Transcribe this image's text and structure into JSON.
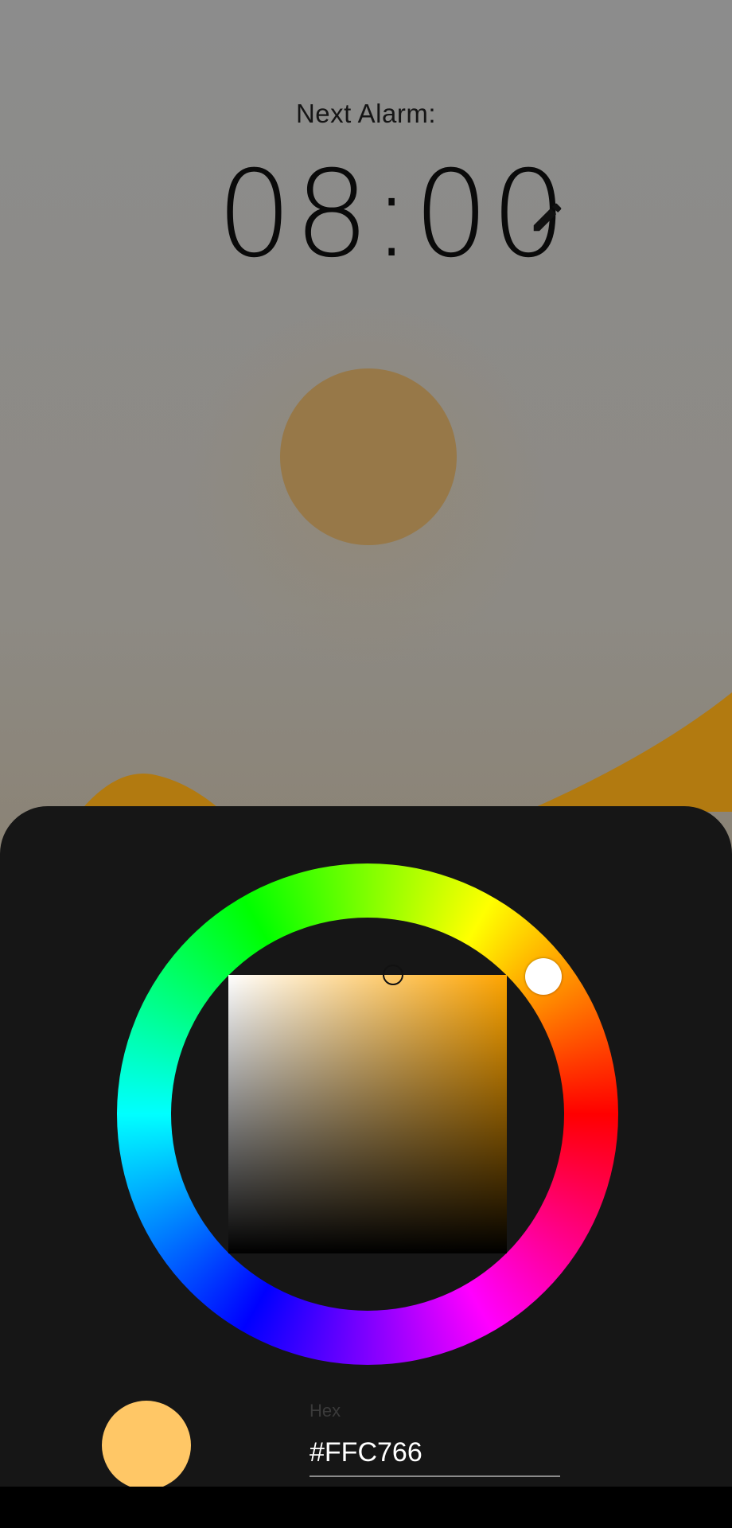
{
  "alarm": {
    "label": "Next Alarm:",
    "time": "08:00"
  },
  "icons": {
    "edit": "pencil-icon"
  },
  "color_picker": {
    "hex_label": "Hex",
    "hex_value": "#FFC766",
    "selected_color": "#FFC766",
    "hue_base_color": "#FFA500"
  },
  "colors": {
    "sheet_background": "#161616",
    "scene_sun": "#977848",
    "scene_hills": "#b27a10"
  }
}
